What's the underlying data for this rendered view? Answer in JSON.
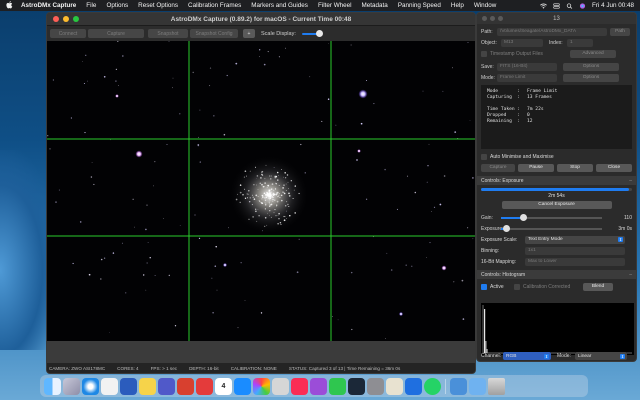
{
  "menubar": {
    "app_name": "AstroDMx Capture",
    "items": [
      "File",
      "Options",
      "Reset Options",
      "Calibration Frames",
      "Markers and Guides",
      "Filter Wheel",
      "Metadata",
      "Panning Speed",
      "Help",
      "Window"
    ],
    "clock": "Fri 4 Jun  00:48"
  },
  "main_window": {
    "title": "AstroDMx Capture (0.89.2) for macOS - Current Time 00:48",
    "toolbar": {
      "connect_label": "Connect",
      "capture_label": "Capture",
      "snapshot_label": "Snapshot",
      "snapshot_config_label": "Snapshot Config",
      "plus_label": "+",
      "scale_display_label": "Scale Display:",
      "scale_display_value": 0.55
    },
    "status_bar": {
      "camera": "CAMERA: ZWO ASI178MC",
      "cores": "CORES: 4",
      "fps": "FPS: > 1 sec",
      "depth": "DEPTH: 16-bit",
      "calibration": "CALIBRATION: NONE",
      "status": "STATUS: Captured 3 of 13 | Time Remaining = 36m 0s"
    }
  },
  "control_panel": {
    "title": "13",
    "path_label": "Path:",
    "path_value": "/Volumes/Seagate/AstroDMx_DATA",
    "path_button": "Path",
    "object_label": "Object:",
    "object_value": "M13",
    "index_label": "Index:",
    "index_value": "1",
    "timestamp_label": "Timestamp Output Files",
    "advanced_button": "Advanced",
    "save_label": "Save:",
    "save_value": "FITS (16-Bit)",
    "save_options_button": "Options",
    "mode_label": "Mode:",
    "mode_value": "Frame Limit",
    "mode_options_button": "Options",
    "stats": [
      {
        "key": "Mode",
        "value": "Frame Limit"
      },
      {
        "key": "Capturing",
        "value": "13 Frames"
      },
      {
        "key": "",
        "value": ""
      },
      {
        "key": "Time Taken",
        "value": "7m 22s"
      },
      {
        "key": "Dropped",
        "value": "0"
      },
      {
        "key": "Remaining",
        "value": "12"
      }
    ],
    "auto_minimise_label": "Auto Minimise and Maximise",
    "capture_button": "Capture",
    "pause_button": "Pause",
    "stop_button": "Stop",
    "close_button": "Close",
    "exposure_section": {
      "header": "Controls: Exposure",
      "progress_fraction": 0.98,
      "progress_text": "2m 54s",
      "cancel_button": "Cancel Exposure",
      "gain_label": "Gain:",
      "gain_value": "110",
      "gain_fraction": 0.22,
      "exposure_label": "Exposure:",
      "exposure_value": "3m 0s",
      "exposure_fraction": 0.05,
      "exposure_scale_label": "Exposure Scale:",
      "exposure_scale_value": "Text Entry Mode",
      "binning_label": "Binning:",
      "binning_value": "1x1",
      "mapping_label": "16-Bit Mapping:",
      "mapping_value": "Max to Lower"
    },
    "histogram_section": {
      "header": "Controls: Histogram",
      "active_label": "Active",
      "calibration_corrected_label": "Calibration Corrected",
      "blend_button": "Blend",
      "channel_label": "Channel:",
      "channel_value": "RGB",
      "mode_label": "Mode:",
      "mode_value": "Linear"
    }
  },
  "dock": {
    "icons": [
      "finder-icon",
      "launchpad-icon",
      "safari-icon",
      "calendar-icon",
      "word-icon",
      "notes-icon",
      "teams-icon",
      "adobe-icon",
      "vivaldi-icon",
      "calendar-date-icon",
      "app-store-icon",
      "photos-icon",
      "utility-icon",
      "music-icon",
      "podcasts-icon",
      "messages-icon",
      "steam-icon",
      "settings-icon",
      "preview-icon",
      "xcode-icon",
      "whatsapp-icon",
      "file-icon",
      "downloads-icon",
      "trash-icon"
    ],
    "calendar_day": "4"
  },
  "colors": {
    "accent": "#1f7cf0",
    "crosshair": "#2bcc2b",
    "window_bg": "#2a2a2a"
  }
}
